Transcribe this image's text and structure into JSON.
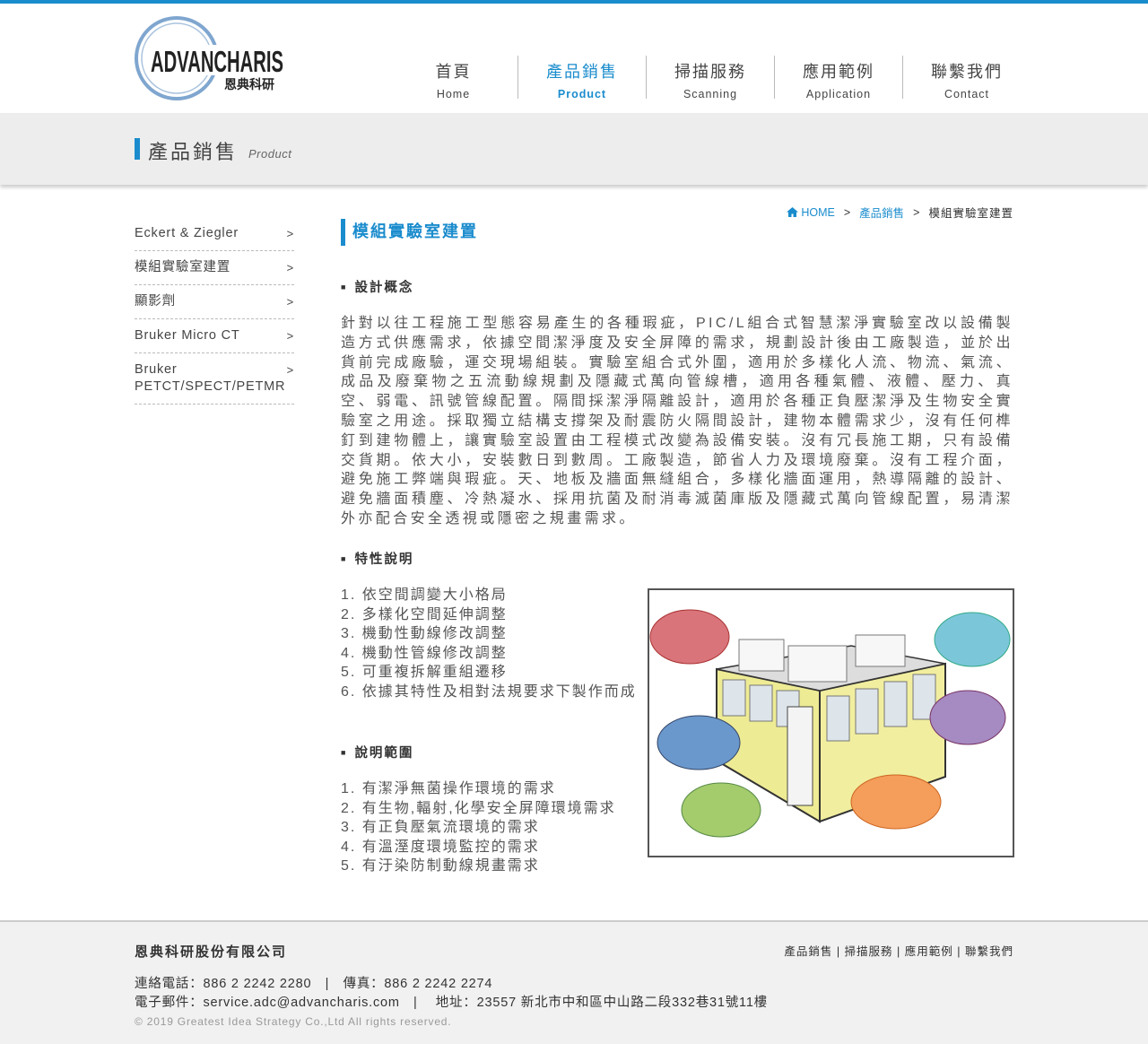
{
  "brand": {
    "logo_text": "ADVANCHARIS",
    "logo_sub": "恩典科研",
    "accent": "#1a8ccd"
  },
  "nav": [
    {
      "zh": "首頁",
      "en": "Home",
      "active": false
    },
    {
      "zh": "產品銷售",
      "en": "Product",
      "active": true
    },
    {
      "zh": "掃描服務",
      "en": "Scanning",
      "active": false
    },
    {
      "zh": "應用範例",
      "en": "Application",
      "active": false
    },
    {
      "zh": "聯繫我們",
      "en": "Contact",
      "active": false
    }
  ],
  "banner": {
    "title": "產品銷售",
    "subtitle": "Product"
  },
  "sidebar": [
    {
      "label": "Eckert & Ziegler",
      "arrow": ">"
    },
    {
      "label": "模組實驗室建置",
      "arrow": ">"
    },
    {
      "label": "顯影劑",
      "arrow": ">"
    },
    {
      "label": "Bruker Micro CT",
      "arrow": ">"
    },
    {
      "label": "Bruker PETCT/SPECT/PETMR",
      "arrow": ">"
    }
  ],
  "breadcrumb": {
    "home": "HOME",
    "sep": ">",
    "section": "產品銷售",
    "current": "模組實驗室建置",
    "home_icon": "home-icon"
  },
  "content": {
    "title": "模組實驗室建置",
    "design_heading": "設計概念",
    "design_text": "針對以往工程施工型態容易產生的各種瑕疵，PIC/L組合式智慧潔淨實驗室改以設備製造方式供應需求，依據空間潔淨度及安全屏障的需求，規劃設計後由工廠製造，並於出貨前完成廠驗，運交現場組裝。實驗室組合式外圍，適用於多樣化人流、物流、氣流、成品及廢棄物之五流動線規劃及隱藏式萬向管線槽，適用各種氣體、液體、壓力、真空、弱電、訊號管線配置。隔間採潔淨隔離設計，適用於各種正負壓潔淨及生物安全實驗室之用途。採取獨立結構支撐架及耐震防火隔間設計，建物本體需求少，沒有任何榫釘到建物體上，讓實驗室設置由工程模式改變為設備安裝。沒有冗長施工期，只有設備交貨期。依大小，安裝數日到數周。工廠製造，節省人力及環境廢棄。沒有工程介面，避免施工弊端與瑕疵。天、地板及牆面無縫組合，多樣化牆面運用，熱導隔離的設計、避免牆面積塵、冷熱凝水、採用抗菌及耐消毒滅菌庫版及隱藏式萬向管線配置，易清潔外亦配合安全透視或隱密之規畫需求。",
    "features_heading": "特性說明",
    "features": [
      "1. 依空間調變大小格局",
      "2. 多樣化空間延伸調整",
      "3. 機動性動線修改調整",
      "4. 機動性管線修改調整",
      "5. 可重複拆解重組遷移",
      "6. 依據其特性及相對法規要求下製作而成"
    ],
    "scope_heading": "說明範圍",
    "scope": [
      "1. 有潔淨無菌操作環境的需求",
      "2. 有生物,輻射,化學安全屏障環境需求",
      "3. 有正負壓氣流環境的需求",
      "4. 有溫溼度環境監控的需求",
      "5. 有汙染防制動線規畫需求"
    ]
  },
  "footer": {
    "company": "恩典科研股份有限公司",
    "links": [
      "產品銷售",
      "掃描服務",
      "應用範例",
      "聯繫我們"
    ],
    "contact_line": "連絡電話：886 2 2242 2280　|　傳真：886 2 2242 2274",
    "email_line": "電子郵件：service.adc@advancharis.com　|　 地址：23557 新北市中和區中山路二段332巷31號11樓",
    "copyright": "© 2019 Greatest Idea Strategy Co.,Ltd All rights reserved."
  }
}
